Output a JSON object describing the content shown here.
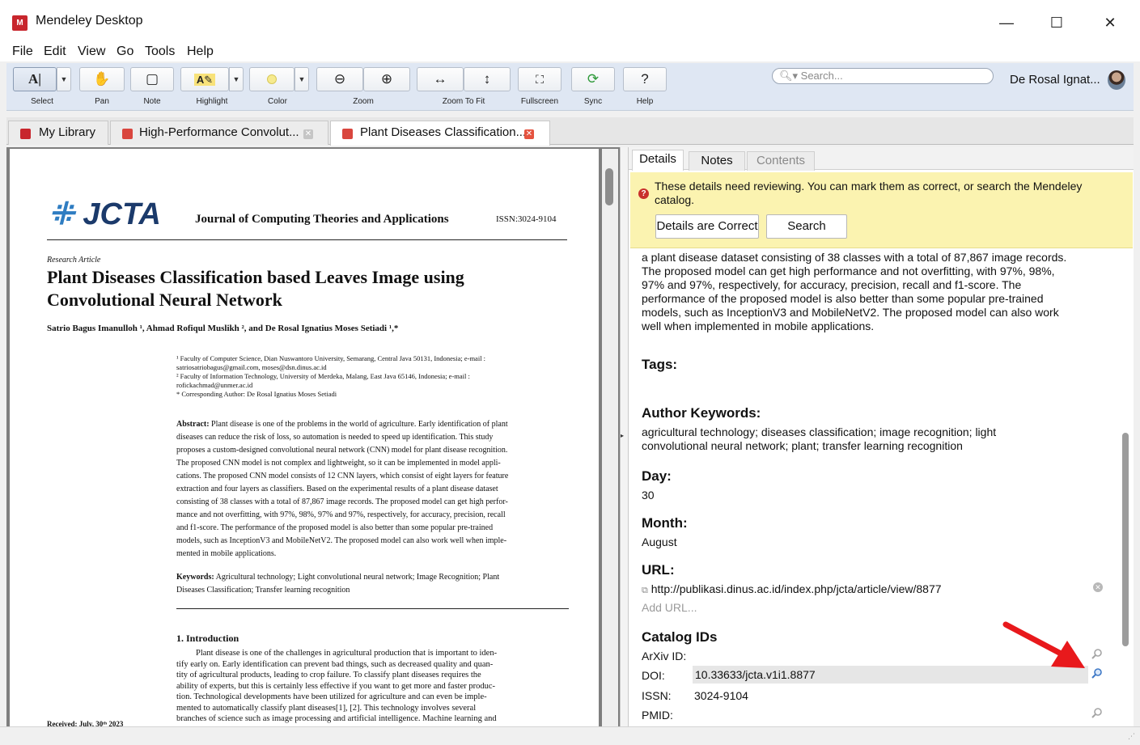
{
  "window": {
    "title": "Mendeley Desktop",
    "app_icon_text": "M"
  },
  "menu": [
    "File",
    "Edit",
    "View",
    "Go",
    "Tools",
    "Help"
  ],
  "toolbar": {
    "labels": {
      "select": "Select",
      "pan": "Pan",
      "note": "Note",
      "highlight": "Highlight",
      "color": "Color",
      "zoom": "Zoom",
      "zoom_to_fit": "Zoom To Fit",
      "fullscreen": "Fullscreen",
      "sync": "Sync",
      "help": "Help"
    },
    "search_placeholder": "Search...",
    "user_name": "De Rosal Ignat..."
  },
  "tabs": [
    {
      "label": "My Library"
    },
    {
      "label": "High-Performance Convolut..."
    },
    {
      "label": "Plant Diseases Classification..."
    }
  ],
  "pdf": {
    "journal_logo": "JCTA",
    "journal_name": "Journal of Computing Theories and Applications",
    "issn": "ISSN:3024-9104",
    "article_type": "Research Article",
    "title_line1": "Plant Diseases Classification based Leaves Image using",
    "title_line2": "Convolutional Neural Network",
    "authors": "Satrio Bagus Imanulloh ¹, Ahmad Rofiqul Muslikh ², and De Rosal Ignatius Moses Setiadi ¹,*",
    "affiliations": [
      "¹  Faculty of Computer Science, Dian Nuswantoro University, Semarang, Central Java 50131, Indonesia; e-mail :",
      "    satriosatriobagus@gmail.com, moses@dsn.dinus.ac.id",
      "²  Faculty of Information Technology, University of Merdeka, Malang, East Java 65146, Indonesia; e-mail :",
      "    rofickachmad@unmer.ac.id",
      "*  Corresponding Author: De Rosal Ignatius Moses Setiadi"
    ],
    "abstract_label": "Abstract:",
    "abstract_lines": [
      " Plant disease is one of the problems in the world of agriculture. Early identification of plant",
      "diseases can reduce the risk of loss, so automation is needed to speed up identification. This study",
      "proposes a custom-designed convolutional neural network (CNN) model for plant disease recognition.",
      "The proposed CNN model is not complex and lightweight, so it can be implemented in model appli-",
      "cations. The proposed CNN model consists of 12 CNN layers, which consist of eight layers for feature",
      "extraction and four layers as classifiers. Based on the experimental results of a plant disease dataset",
      "consisting of 38 classes with a total of 87,867 image records. The proposed model can get high perfor-",
      "mance and not overfitting, with 97%, 98%, 97% and 97%, respectively, for accuracy, precision, recall",
      "and f1-score. The performance of the proposed model is also better than some popular pre-trained",
      "models, such as InceptionV3 and MobileNetV2. The proposed model can also work well when imple-",
      "mented in mobile applications."
    ],
    "keywords_label": "Keywords:",
    "keywords_line1": " Agricultural technology; Light convolutional neural network; Image Recognition; Plant",
    "keywords_line2": "Diseases Classification; Transfer learning recognition",
    "intro_heading": "1. Introduction",
    "intro_lines": [
      "Plant disease is one of the challenges in agricultural production that is important to iden-",
      "tify early on. Early identification can prevent bad things, such as decreased quality and quan-",
      "tity of agricultural products, leading to crop failure. To classify plant diseases requires the",
      "ability of experts, but this is certainly less effective if you want to get more and faster produc-",
      "tion. Technological developments have been utilized for agriculture and can even be imple-",
      "mented to automatically classify plant diseases[1], [2]. This technology involves several",
      "branches of science such as image processing and artificial intelligence. Machine learning and"
    ],
    "received": "Received: July, 30ᵗʰ 2023"
  },
  "details": {
    "tabs": [
      "Details",
      "Notes",
      "Contents"
    ],
    "review_message": "These details need reviewing. You can mark them as correct, or search the Mendeley catalog.",
    "btn_correct": "Details are Correct",
    "btn_search": "Search",
    "abstract_lines": [
      "a plant disease dataset consisting of 38 classes with a total of 87,867 image records.",
      "The proposed model can get high performance and not overfitting, with 97%, 98%,",
      "97% and 97%, respectively, for accuracy, precision, recall and f1-score. The",
      "performance of the proposed model is also better than some popular pre-trained",
      "models, such as InceptionV3 and MobileNetV2. The proposed model can also work",
      "well when implemented in mobile applications."
    ],
    "tags_label": "Tags:",
    "author_keywords_label": "Author Keywords:",
    "author_keywords_line1": "agricultural technology; diseases classification; image recognition; light",
    "author_keywords_line2": "convolutional neural network; plant; transfer learning recognition",
    "day_label": "Day:",
    "day_value": "30",
    "month_label": "Month:",
    "month_value": "August",
    "url_label": "URL:",
    "url_value": "http://publikasi.dinus.ac.id/index.php/jcta/article/view/8877",
    "add_url": "Add URL...",
    "catalog_label": "Catalog IDs",
    "arxiv_label": "ArXiv ID:",
    "doi_label": "DOI:",
    "doi_value": "10.33633/jcta.v1i1.8877",
    "issn_label": "ISSN:",
    "issn_value": "3024-9104",
    "pmid_label": "PMID:"
  },
  "colors": {
    "annotation_arrow": "#e8191c",
    "brand": "#c8262d",
    "review_bg": "#fbf3b0"
  }
}
